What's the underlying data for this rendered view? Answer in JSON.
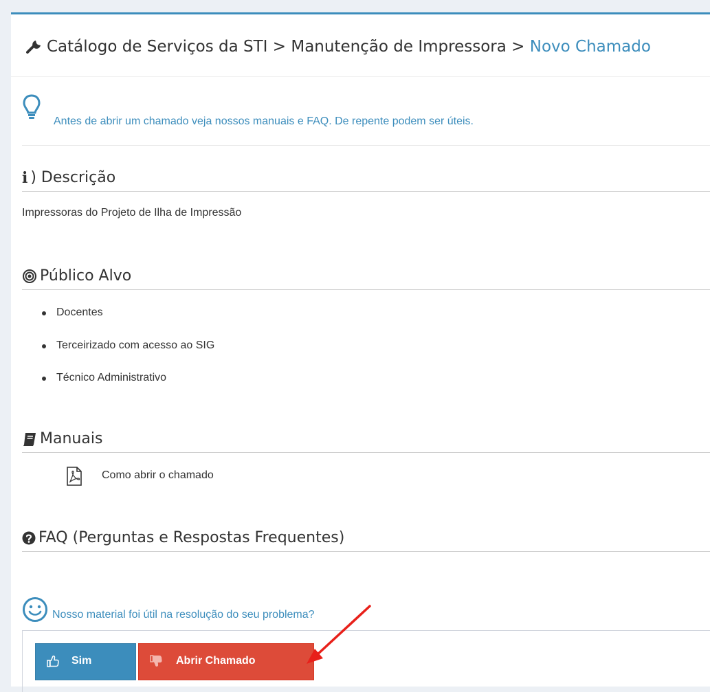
{
  "breadcrumb": {
    "part1": "Catálogo de Serviços da STI",
    "sep1": ">",
    "part2": "Manutenção de Impressora",
    "sep2": ">",
    "current": "Novo Chamado"
  },
  "tip": {
    "text": "Antes de abrir um chamado veja nossos manuais e FAQ. De repente podem ser úteis.",
    "icon": "lightbulb-icon"
  },
  "description": {
    "title": ") Descrição",
    "icon_glyph": "i",
    "text": "Impressoras do Projeto de Ilha de Impressão"
  },
  "audience": {
    "title": "Público Alvo",
    "icon": "bullseye-icon",
    "items": [
      "Docentes",
      "Terceirizado com acesso ao SIG",
      "Técnico Administrativo"
    ]
  },
  "manuals": {
    "title": "Manuais",
    "icon": "book-icon",
    "items": [
      {
        "label": "Como abrir o chamado",
        "icon": "pdf-file-icon"
      }
    ]
  },
  "faq": {
    "title": "FAQ (Perguntas e Respostas Frequentes)",
    "icon": "question-circle-icon"
  },
  "feedback": {
    "question": "Nosso material foi útil na resolução do seu problema?",
    "icon": "smile-icon",
    "yes_label": "Sim",
    "no_label": "Abrir Chamado"
  },
  "colors": {
    "primary": "#3c8dbc",
    "danger": "#dd4b39",
    "annotation_arrow": "#e8201a",
    "background": "#ecf0f5"
  }
}
